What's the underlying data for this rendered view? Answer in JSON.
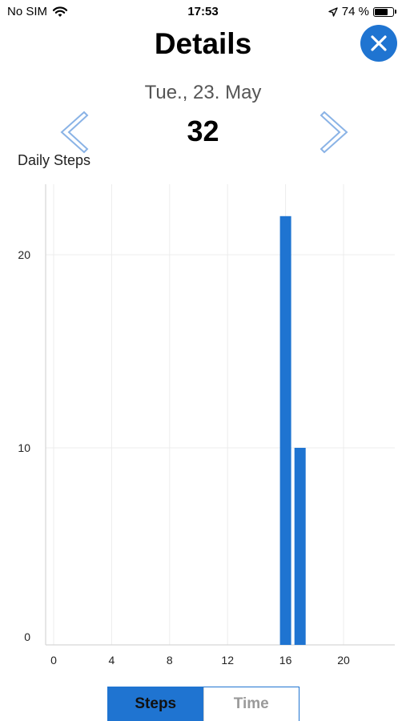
{
  "status": {
    "carrier": "No SIM",
    "time": "17:53",
    "battery": "74 %",
    "battery_level": 0.74
  },
  "header": {
    "title": "Details"
  },
  "date": "Tue., 23. May",
  "total_steps": "32",
  "chart_title": "Daily Steps",
  "tabs": {
    "steps": "Steps",
    "time": "Time"
  },
  "colors": {
    "accent": "#1f74d1"
  },
  "icons": {
    "close": "close-icon",
    "prev": "chevron-left-icon",
    "next": "chevron-right-icon",
    "wifi": "wifi-icon",
    "location": "location-arrow-icon",
    "battery": "battery-icon"
  },
  "chart_data": {
    "type": "bar",
    "title": "Daily Steps",
    "x": [
      16,
      17
    ],
    "values": [
      22,
      10
    ],
    "xlim": [
      0,
      23
    ],
    "ylim": [
      0,
      23
    ],
    "xticks": [
      "0",
      "4",
      "8",
      "12",
      "16",
      "20"
    ],
    "yticks": [
      "0",
      "10",
      "20"
    ],
    "grid": true,
    "color": "#1f74d1"
  }
}
